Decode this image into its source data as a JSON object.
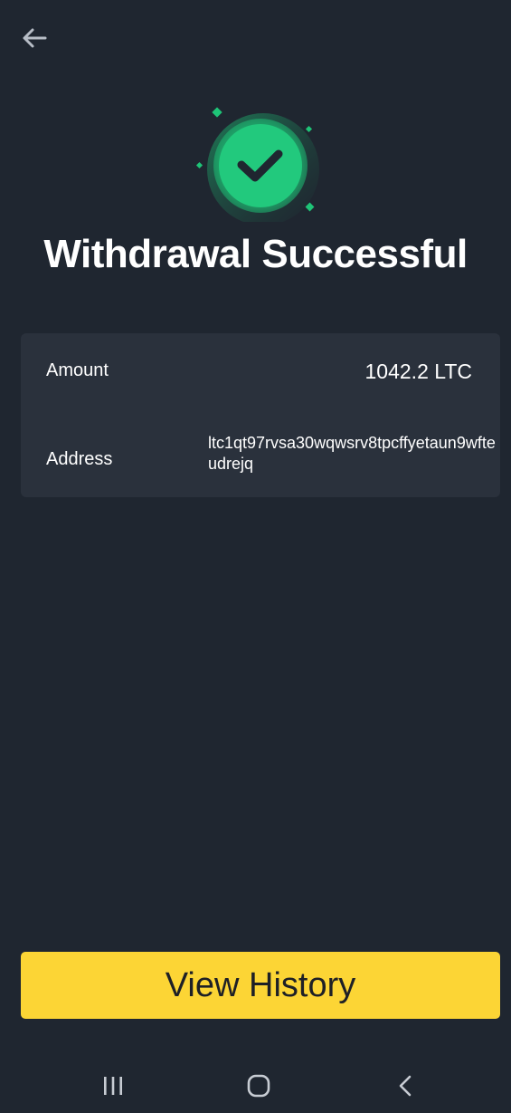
{
  "header": {
    "back_icon": "arrow-left-icon"
  },
  "hero": {
    "icon": "success-check-icon",
    "title": "Withdrawal Successful",
    "accent_color": "#1ec477"
  },
  "details": {
    "amount_label": "Amount",
    "amount_value": "1042.2 LTC",
    "address_label": "Address",
    "address_value": "ltc1qt97rvsa30wqwsrv8tpcffyetaun9wfteudrejq"
  },
  "actions": {
    "view_history_label": "View History",
    "button_color": "#fcd535"
  },
  "system_nav": {
    "recents_icon": "recents-icon",
    "home_icon": "home-icon",
    "back_icon": "system-back-icon"
  }
}
